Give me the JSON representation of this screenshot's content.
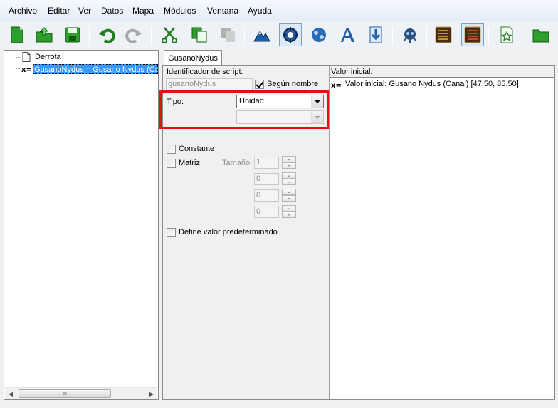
{
  "menu": {
    "items": [
      "Archivo",
      "Editar",
      "Ver",
      "Datos",
      "Mapa",
      "Módulos",
      "Ventana",
      "Ayuda"
    ]
  },
  "toolbar": {
    "buttons": [
      {
        "icon": "new-document-icon"
      },
      {
        "icon": "open-folder-icon"
      },
      {
        "icon": "save-disk-icon"
      },
      {
        "icon": "undo-arrow-icon"
      },
      {
        "icon": "redo-arrow-icon"
      },
      {
        "icon": "scissors-icon"
      },
      {
        "icon": "copy-icon"
      },
      {
        "icon": "paste-icon"
      },
      {
        "icon": "terrain-editor-icon"
      },
      {
        "icon": "trigger-editor-icon"
      },
      {
        "icon": "data-editor-icon"
      },
      {
        "icon": "text-editor-icon"
      },
      {
        "icon": "import-icon"
      },
      {
        "icon": "ai-editor-icon"
      },
      {
        "icon": "list-panel-icon"
      },
      {
        "icon": "list-panel-active-icon"
      },
      {
        "icon": "document-star-icon"
      },
      {
        "icon": "folder-icon"
      }
    ]
  },
  "tree": {
    "items": [
      {
        "icon": "document-icon",
        "label": "Derrota",
        "selected": false
      },
      {
        "icon": "variable-icon",
        "label": "GusanoNydus = Gusano Nydus (Car",
        "selected": true
      }
    ],
    "hscroll_grip": "III"
  },
  "tab": {
    "label": "GusanoNydus"
  },
  "form": {
    "script_id_label": "Identificador de script:",
    "script_id_value": "gusanoNydus",
    "by_name_label": "Según nombre",
    "by_name_checked": true,
    "type_label": "Tipo:",
    "type_value": "Unidad",
    "subtype_value": "",
    "constant_label": "Constante",
    "constant_checked": false,
    "matrix_label": "Matriz",
    "matrix_checked": false,
    "size_label": "Tamaño:",
    "size_values": [
      "1",
      "0",
      "0",
      "0"
    ],
    "default_label": "Define valor predeterminado",
    "default_checked": false
  },
  "initial_value": {
    "label": "Valor inicial:",
    "icon": "variable-icon",
    "text": "Valor inicial: Gusano Nydus (Canal) [47.50, 85.50]"
  },
  "colors": {
    "highlight_border": "#e31010",
    "selection": "#3399ff"
  }
}
